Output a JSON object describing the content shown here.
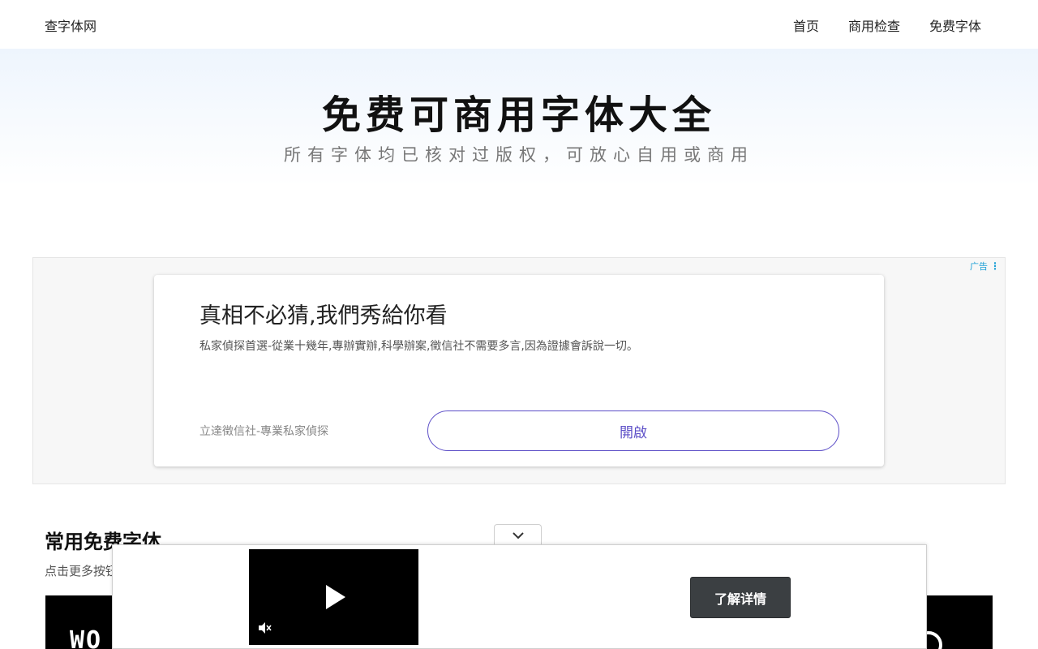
{
  "header": {
    "logo": "查字体网",
    "nav": [
      "首页",
      "商用检查",
      "免费字体"
    ]
  },
  "hero": {
    "title": "免费可商用字体大全",
    "subtitle": "所有字体均已核对过版权，可放心自用或商用"
  },
  "ad": {
    "tag": "广告",
    "headline": "真相不必猜,我們秀給你看",
    "description": "私家偵探首選-從業十幾年,專辦實辦,科學辦案,徵信社不需要多言,因為證據會訴說一切。",
    "advertiser": "立達徵信社-專業私家偵探",
    "cta": "開啟"
  },
  "section": {
    "title": "常用免费字体",
    "hint": "点击更多按钮"
  },
  "video_overlay": {
    "cta": "了解详情"
  },
  "icons": {
    "collapse": "chevron-down-icon",
    "play": "play-icon",
    "mute": "mute-icon",
    "ad_menu": "more-vertical-icon"
  }
}
